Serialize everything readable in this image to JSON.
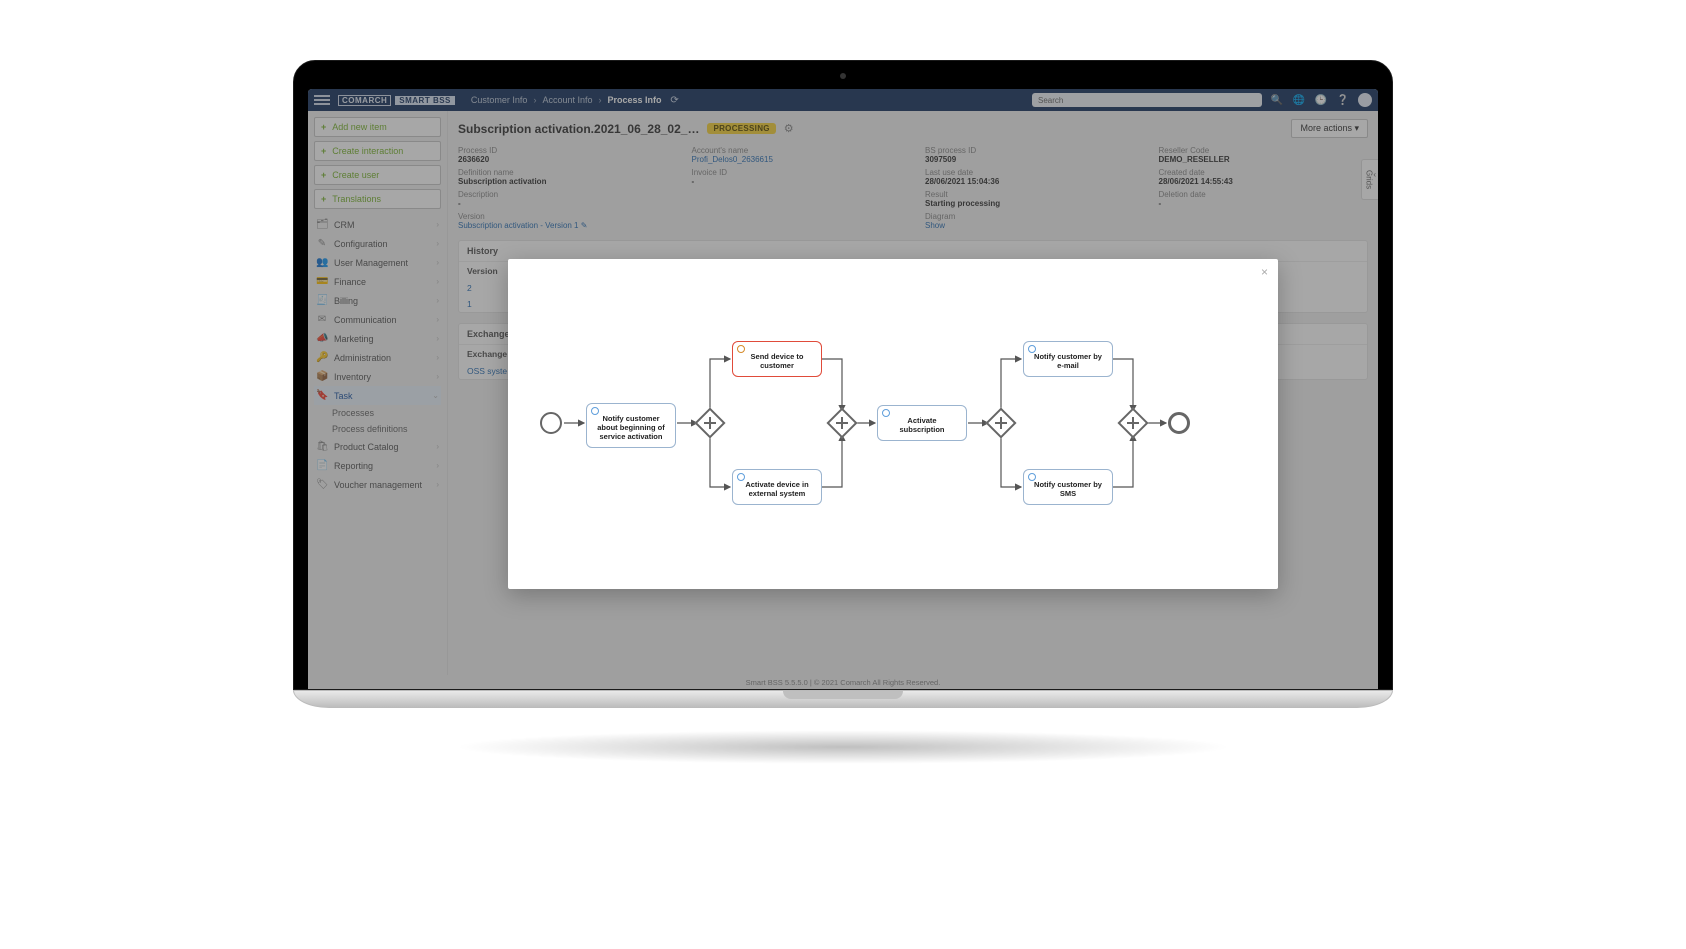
{
  "brand": {
    "name": "COMARCH",
    "tag": "SMART BSS"
  },
  "breadcrumbs": [
    "Customer Info",
    "Account Info",
    "Process Info"
  ],
  "search_placeholder": "Search",
  "actions": {
    "add_item": "Add new item",
    "create_interaction": "Create interaction",
    "create_user": "Create user",
    "translations": "Translations"
  },
  "nav": [
    {
      "icon": "🗂",
      "label": "CRM"
    },
    {
      "icon": "✎",
      "label": "Configuration"
    },
    {
      "icon": "👥",
      "label": "User Management"
    },
    {
      "icon": "💳",
      "label": "Finance"
    },
    {
      "icon": "🧾",
      "label": "Billing"
    },
    {
      "icon": "✉",
      "label": "Communication"
    },
    {
      "icon": "📣",
      "label": "Marketing"
    },
    {
      "icon": "🔑",
      "label": "Administration"
    },
    {
      "icon": "📦",
      "label": "Inventory"
    },
    {
      "icon": "🔖",
      "label": "Task",
      "active": true,
      "children": [
        "Processes",
        "Process definitions"
      ]
    },
    {
      "icon": "🛍",
      "label": "Product Catalog"
    },
    {
      "icon": "📄",
      "label": "Reporting"
    },
    {
      "icon": "🏷",
      "label": "Voucher management"
    }
  ],
  "page": {
    "title": "Subscription activation.2021_06_28_02_…",
    "status": "PROCESSING",
    "more_actions": "More actions ▾"
  },
  "meta": [
    {
      "label": "Process ID",
      "value": "2636620"
    },
    {
      "label": "Account's name",
      "value": "Profi_Delos0_2636615",
      "link": true
    },
    {
      "label": "BS process ID",
      "value": "3097509"
    },
    {
      "label": "Reseller Code",
      "value": "DEMO_RESELLER"
    },
    {
      "label": "Definition name",
      "value": "Subscription activation"
    },
    {
      "label": "Invoice ID",
      "value": "-"
    },
    {
      "label": "Last use date",
      "value": "28/06/2021 15:04:36"
    },
    {
      "label": "Created date",
      "value": "28/06/2021 14:55:43"
    },
    {
      "label": "Description",
      "value": "-"
    },
    {
      "label": "",
      "value": ""
    },
    {
      "label": "Result",
      "value": "Starting processing"
    },
    {
      "label": "Deletion date",
      "value": "-"
    },
    {
      "label": "Version",
      "value": "Subscription activation - Version 1  ✎",
      "link": true
    },
    {
      "label": "",
      "value": ""
    },
    {
      "label": "Diagram",
      "value": "Show",
      "link": true
    },
    {
      "label": "",
      "value": ""
    }
  ],
  "history": {
    "title": "History",
    "header": "Version",
    "rows": [
      "2",
      "1"
    ]
  },
  "exchange": {
    "title": "Exchange…",
    "header": "Exchange",
    "rows": [
      "OSS syste…"
    ]
  },
  "grids_tab": "Grids",
  "footer": "Smart BSS 5.5.5.0 | © 2021 Comarch All Rights Reserved.",
  "modal": {
    "nodes": {
      "n1": "Notify customer about beginning of service activation",
      "n2": "Send device to customer",
      "n3": "Activate device in external system",
      "n4": "Activate subscription",
      "n5": "Notify customer by e-mail",
      "n6": "Notify customer by SMS"
    }
  }
}
